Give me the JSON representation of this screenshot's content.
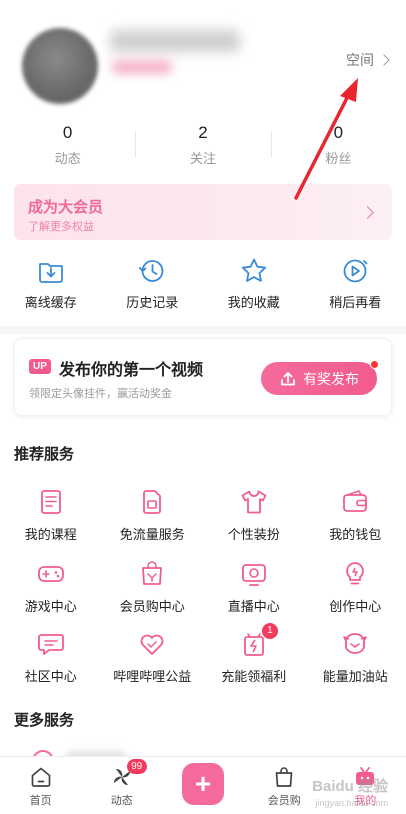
{
  "profile": {
    "space_label": "空间"
  },
  "stats": [
    {
      "num": "0",
      "label": "动态"
    },
    {
      "num": "2",
      "label": "关注"
    },
    {
      "num": "0",
      "label": "粉丝"
    }
  ],
  "vip_banner": {
    "title": "成为大会员",
    "subtitle": "了解更多权益"
  },
  "quick_actions": [
    {
      "label": "离线缓存",
      "icon": "download-icon"
    },
    {
      "label": "历史记录",
      "icon": "history-icon"
    },
    {
      "label": "我的收藏",
      "icon": "star-icon"
    },
    {
      "label": "稍后再看",
      "icon": "watch-later-icon"
    }
  ],
  "upload_card": {
    "tag": "UP",
    "title": "发布你的第一个视频",
    "subtitle": "领限定头像挂件，赢活动奖金",
    "button": "有奖发布"
  },
  "recommended": {
    "title": "推荐服务",
    "rows": [
      [
        {
          "label": "我的课程",
          "icon": "course-icon"
        },
        {
          "label": "免流量服务",
          "icon": "sim-card-icon"
        },
        {
          "label": "个性装扮",
          "icon": "tshirt-icon"
        },
        {
          "label": "我的钱包",
          "icon": "wallet-icon"
        }
      ],
      [
        {
          "label": "游戏中心",
          "icon": "gamepad-icon"
        },
        {
          "label": "会员购中心",
          "icon": "shopping-bag-icon"
        },
        {
          "label": "直播中心",
          "icon": "live-tv-icon"
        },
        {
          "label": "创作中心",
          "icon": "lightbulb-icon"
        }
      ],
      [
        {
          "label": "社区中心",
          "icon": "chat-icon"
        },
        {
          "label": "哔哩哔哩公益",
          "icon": "heart-icon"
        },
        {
          "label": "充能领福利",
          "icon": "gift-icon",
          "badge": "1"
        },
        {
          "label": "能量加油站",
          "icon": "energy-icon"
        }
      ]
    ]
  },
  "more_services": {
    "title": "更多服务"
  },
  "tabbar": [
    {
      "label": "首页",
      "icon": "home-icon"
    },
    {
      "label": "动态",
      "icon": "pinwheel-icon",
      "badge": "99"
    },
    {
      "label": "",
      "icon": "plus-icon"
    },
    {
      "label": "会员购",
      "icon": "bag-icon"
    },
    {
      "label": "我的",
      "icon": "tv-icon"
    }
  ],
  "watermark": {
    "brand": "Baidu 经验",
    "url": "jingyan.baidu.com"
  },
  "colors": {
    "accent": "#f25d8e",
    "arrow": "#e8262e"
  }
}
